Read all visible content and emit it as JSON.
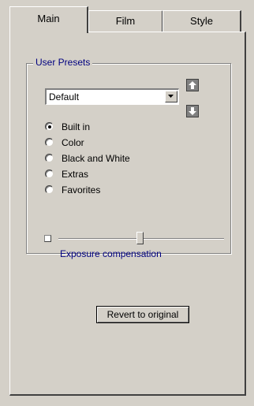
{
  "tabs": [
    {
      "label": "Main",
      "active": true
    },
    {
      "label": "Film",
      "active": false
    },
    {
      "label": "Style",
      "active": false
    }
  ],
  "presets": {
    "group_label": "User Presets",
    "selected_preset": "Default",
    "move_up_icon": "arrow-up-icon",
    "move_down_icon": "arrow-down-icon"
  },
  "categories": [
    {
      "label": "Built in",
      "checked": true
    },
    {
      "label": "Color",
      "checked": false
    },
    {
      "label": "Black and White",
      "checked": false
    },
    {
      "label": "Extras",
      "checked": false
    },
    {
      "label": "Favorites",
      "checked": false
    }
  ],
  "slider": {
    "label": "Exposure compensation",
    "position_fraction": 0.5
  },
  "revert_button": "Revert to original",
  "colors": {
    "face": "#d4d0c8",
    "label_blue": "#000080"
  }
}
